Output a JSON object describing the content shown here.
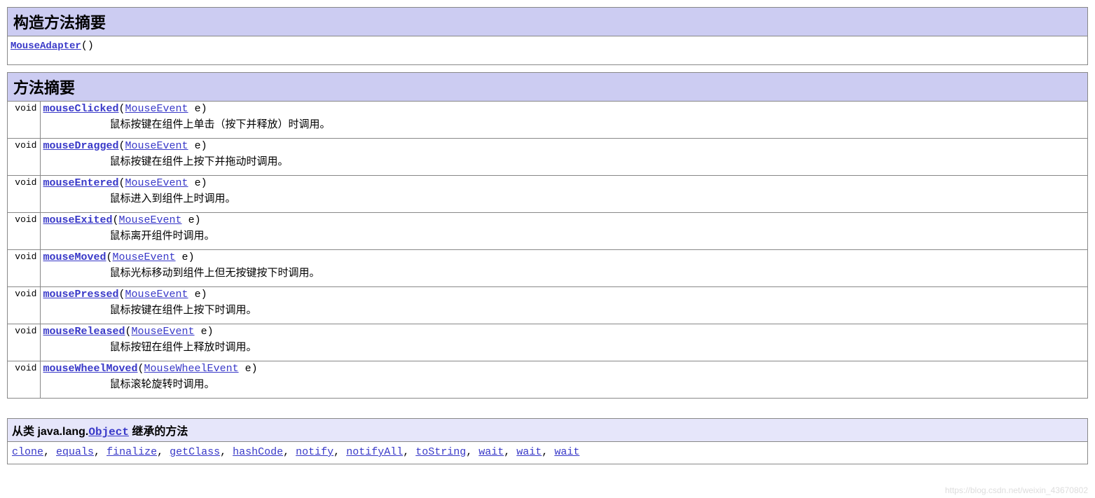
{
  "constructor_section": {
    "title": "构造方法摘要",
    "name": "MouseAdapter",
    "parens": "()"
  },
  "method_section": {
    "title": "方法摘要",
    "methods": [
      {
        "ret": "void",
        "name": "mouseClicked",
        "param_type": "MouseEvent",
        "param_name": " e",
        "desc": "鼠标按键在组件上单击（按下并释放）时调用。"
      },
      {
        "ret": "void",
        "name": "mouseDragged",
        "param_type": "MouseEvent",
        "param_name": " e",
        "desc": "鼠标按键在组件上按下并拖动时调用。"
      },
      {
        "ret": "void",
        "name": "mouseEntered",
        "param_type": "MouseEvent",
        "param_name": " e",
        "desc": "鼠标进入到组件上时调用。"
      },
      {
        "ret": "void",
        "name": "mouseExited",
        "param_type": "MouseEvent",
        "param_name": " e",
        "desc": "鼠标离开组件时调用。"
      },
      {
        "ret": "void",
        "name": "mouseMoved",
        "param_type": "MouseEvent",
        "param_name": " e",
        "desc": "鼠标光标移动到组件上但无按键按下时调用。"
      },
      {
        "ret": "void",
        "name": "mousePressed",
        "param_type": "MouseEvent",
        "param_name": " e",
        "desc": "鼠标按键在组件上按下时调用。"
      },
      {
        "ret": "void",
        "name": "mouseReleased",
        "param_type": "MouseEvent",
        "param_name": " e",
        "desc": "鼠标按钮在组件上释放时调用。"
      },
      {
        "ret": "void",
        "name": "mouseWheelMoved",
        "param_type": "MouseWheelEvent",
        "param_name": " e",
        "desc": "鼠标滚轮旋转时调用。"
      }
    ]
  },
  "inherited": {
    "prefix": "从类 java.lang.",
    "class_link": "Object",
    "suffix": " 继承的方法",
    "methods": [
      "clone",
      "equals",
      "finalize",
      "getClass",
      "hashCode",
      "notify",
      "notifyAll",
      "toString",
      "wait",
      "wait",
      "wait"
    ]
  },
  "watermark": "https://blog.csdn.net/weixin_43670802",
  "paren_open": "(",
  "paren_close": ")"
}
